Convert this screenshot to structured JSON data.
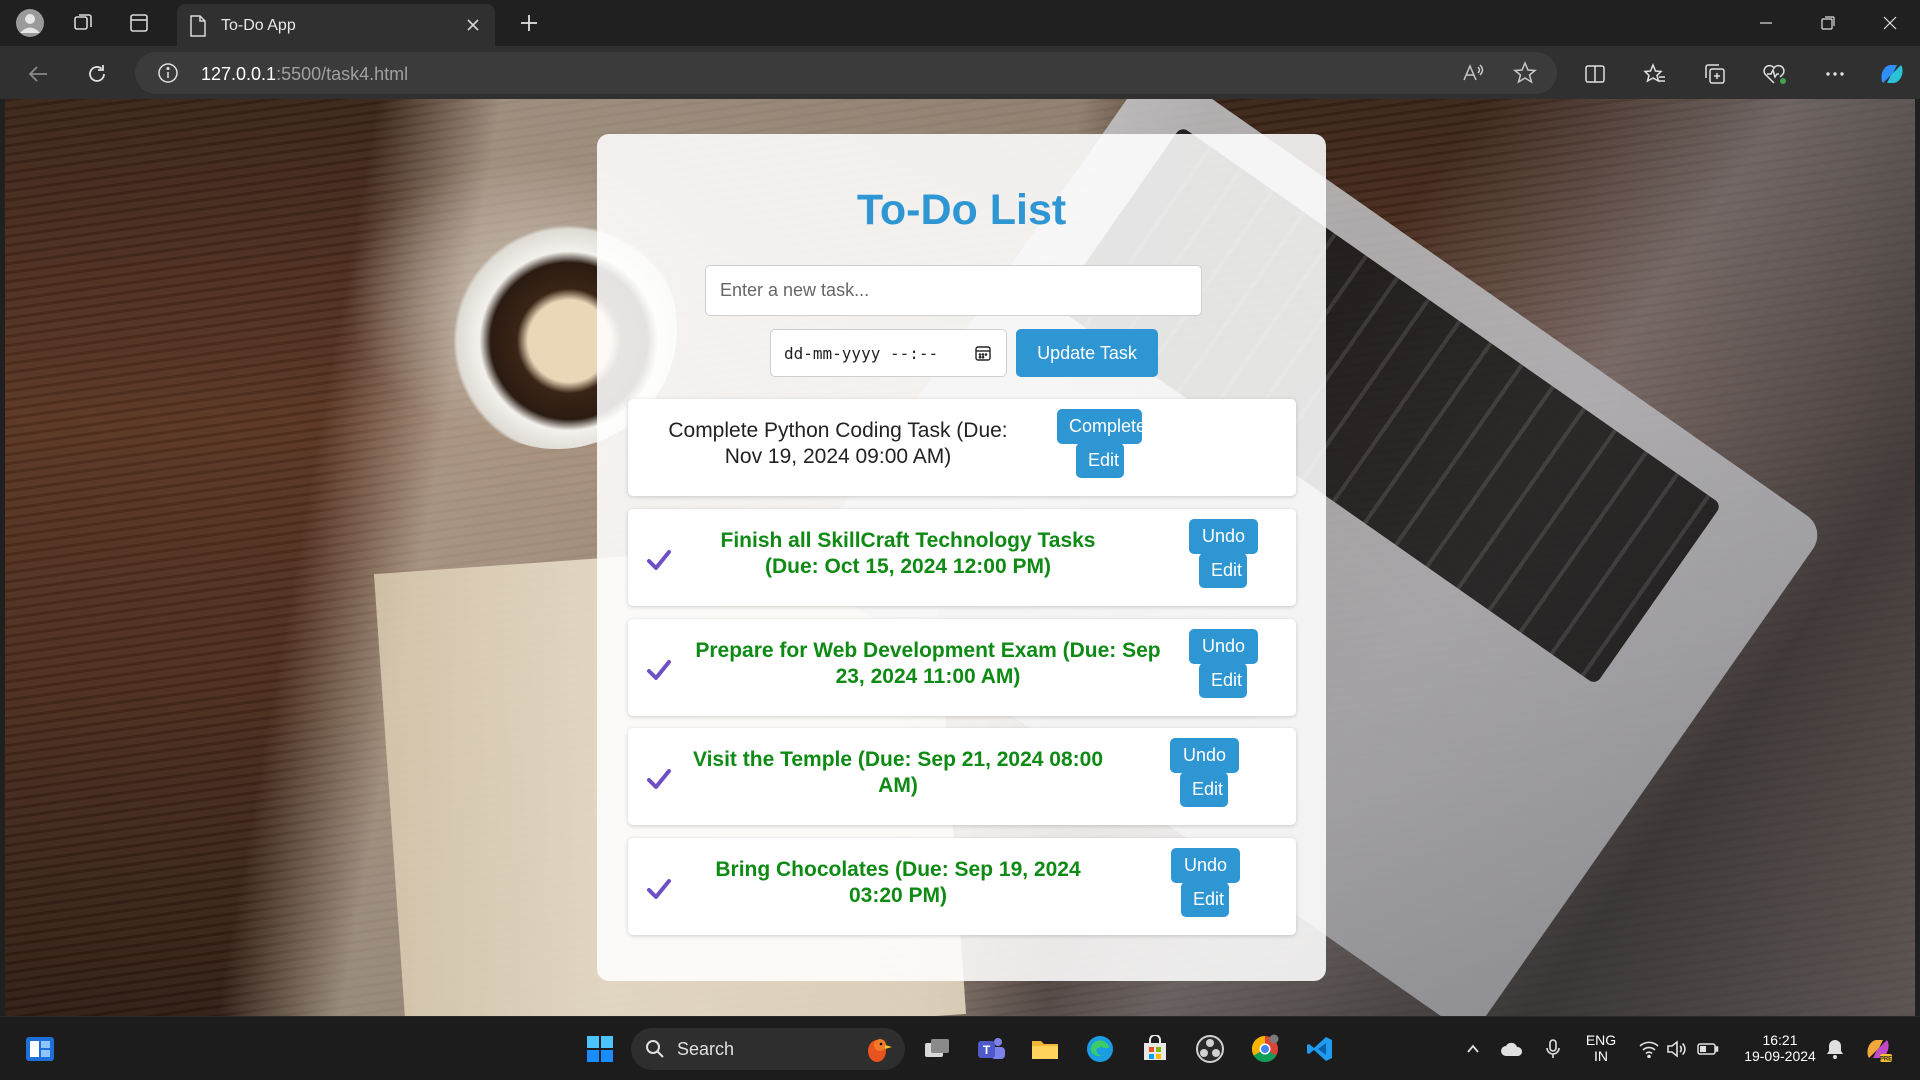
{
  "browser": {
    "tab_title": "To-Do App",
    "url_host": "127.0.0.1",
    "url_rest": ":5500/task4.html"
  },
  "app": {
    "title": "To-Do List",
    "task_placeholder": "Enter a new task...",
    "date_placeholder": "dd-mm-yyyy --:--",
    "update_label": "Update Task",
    "accent_color": "#2e96d3",
    "done_color": "#0f8a14",
    "check_color": "#6f4fc4",
    "tasks": [
      {
        "text": "Complete Python Coding Task (Due: Nov 19, 2024 09:00 AM)",
        "completed": false,
        "action_label": "Complete",
        "edit_label": "Edit"
      },
      {
        "text": "Finish all SkillCraft Technology Tasks (Due: Oct 15, 2024 12:00 PM)",
        "completed": true,
        "action_label": "Undo",
        "edit_label": "Edit"
      },
      {
        "text": "Prepare for Web Development Exam (Due: Sep 23, 2024 11:00 AM)",
        "completed": true,
        "action_label": "Undo",
        "edit_label": "Edit"
      },
      {
        "text": "Visit the Temple (Due: Sep 21, 2024 08:00 AM)",
        "completed": true,
        "action_label": "Undo",
        "edit_label": "Edit"
      },
      {
        "text": "Bring Chocolates (Due: Sep 19, 2024 03:20 PM)",
        "completed": true,
        "action_label": "Undo",
        "edit_label": "Edit"
      }
    ]
  },
  "taskbar": {
    "search_label": "Search",
    "lang_top": "ENG",
    "lang_bottom": "IN",
    "time": "16:21",
    "date": "19-09-2024"
  }
}
